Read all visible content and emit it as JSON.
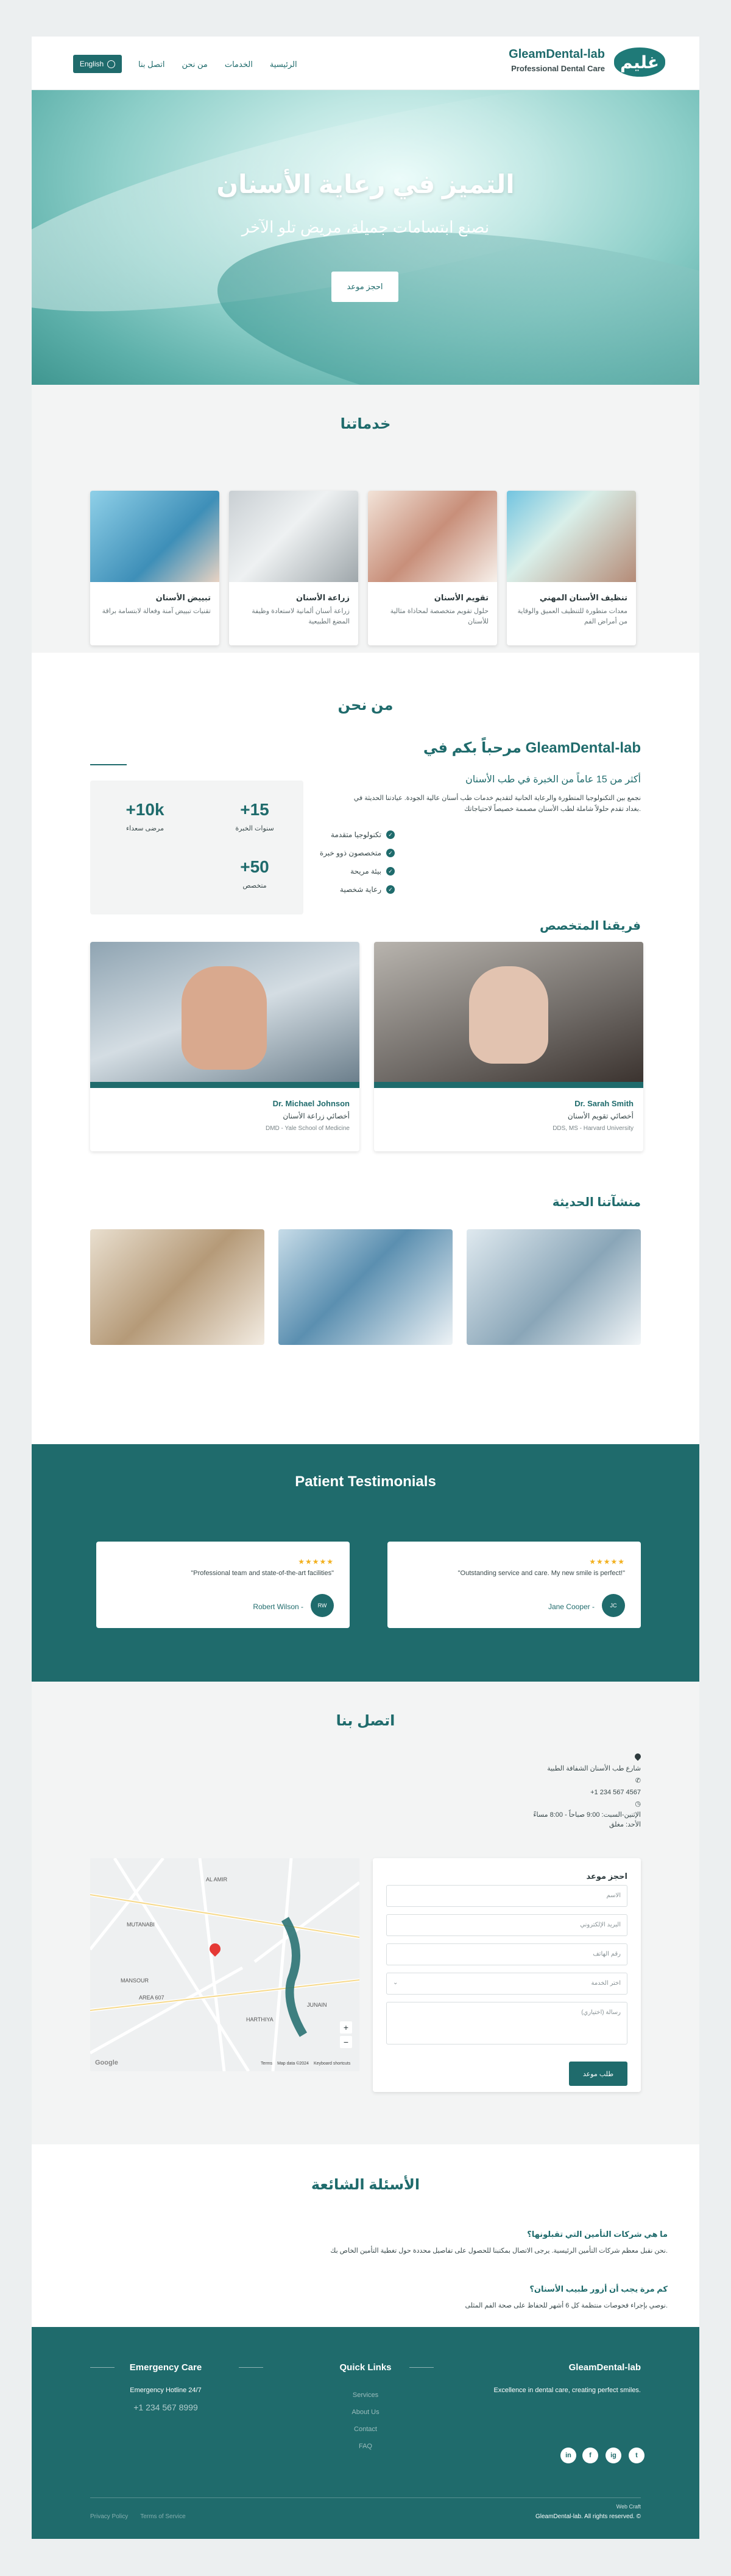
{
  "header": {
    "lang": "English",
    "nav": [
      "الرئيسية",
      "الخدمات",
      "من نحن",
      "اتصل بنا"
    ],
    "brand": "GleamDental-lab",
    "tagline": "Professional Dental Care",
    "logo_text": "غليم"
  },
  "hero": {
    "title": "التميز في رعاية الأسنان",
    "subtitle": "نصنع ابتسامات جميلة، مريض تلو الآخر",
    "cta": "احجز موعد"
  },
  "services": {
    "title": "خدماتنا",
    "items": [
      {
        "title": "تبييض الأسنان",
        "desc": "تقنيات تبييض آمنة وفعالة لابتسامة براقة"
      },
      {
        "title": "زراعة الأسنان",
        "desc": "زراعة أسنان ألمانية لاستعادة وظيفة المضغ الطبيعية"
      },
      {
        "title": "تقويم الأسنان",
        "desc": "حلول تقويم متخصصة لمحاذاة مثالية للأسنان"
      },
      {
        "title": "تنظيف الأسنان المهني",
        "desc": "معدات متطورة للتنظيف العميق والوقاية من أمراض الفم"
      }
    ]
  },
  "about": {
    "title": "من نحن",
    "heading": "مرحباً بكم في GleamDental-lab",
    "sub": "أكثر من 15 عاماً من الخبرة في طب الأسنان",
    "text1": "نجمع بين التكنولوجيا المتطورة والرعاية الحانية لتقديم خدمات طب أسنان عالية الجودة. عيادتنا الحديثة في",
    "text2": "بغداد تقدم حلولاً شاملة لطب الأسنان مصممة خصيصاً لاحتياجاتك.",
    "features": [
      "تكنولوجيا متقدمة",
      "متخصصون ذوو خبرة",
      "بيئة مريحة",
      "رعاية شخصية"
    ],
    "stats": [
      {
        "n": "+15",
        "l": "سنوات الخبرة"
      },
      {
        "n": "+10k",
        "l": "مرضى سعداء"
      },
      {
        "n": "+50",
        "l": "متخصص"
      }
    ],
    "team_title": "فريقنا المتخصص",
    "team": [
      {
        "name": "Dr. Sarah Smith",
        "role": "أخصائي تقويم الأسنان",
        "deg": "DDS, MS - Harvard University"
      },
      {
        "name": "Dr. Michael Johnson",
        "role": "أخصائي زراعة الأسنان",
        "deg": "DMD - Yale School of Medicine"
      }
    ],
    "fac_title": "منشآتنا الحديثة"
  },
  "testimonials": {
    "title": "Patient Testimonials",
    "stars": "★★★★★",
    "items": [
      {
        "quote": "\"Outstanding service and care. My new smile is perfect!\"",
        "name": "Jane Cooper -",
        "initials": "JC"
      },
      {
        "quote": "\"Professional team and state-of-the-art facilities\"",
        "name": "Robert Wilson -",
        "initials": "RW"
      }
    ]
  },
  "contact": {
    "title": "اتصل بنا",
    "address": "شارع طب الأسنان الشفافة الطبية",
    "phone": "+1 234 567 4567",
    "hours1": "الإثنين-السبت: 9:00 صباحاً - 8:00 مساءً",
    "hours2": "الأحد: مغلق",
    "form": {
      "title": "احجز موعد",
      "name": "الاسم",
      "email": "البريد الإلكتروني",
      "phone": "رقم الهاتف",
      "service": "اختر الخدمة",
      "message": "رسالة (اختياري)",
      "submit": "طلب موعد"
    },
    "map": {
      "labels": [
        "MUTANABI",
        "MANSOUR",
        "AREA 607",
        "HARTHIYA",
        "JUNAIN",
        "AL AMIR"
      ],
      "terms": "Terms",
      "report": "Map data ©2024",
      "keys": "Keyboard shortcuts",
      "google": "Google"
    }
  },
  "faq": {
    "title": "الأسئلة الشائعة",
    "items": [
      {
        "q": "ما هي شركات التأمين التي تقبلونها؟",
        "a": "نحن نقبل معظم شركات التأمين الرئيسية. يرجى الاتصال بمكتبنا للحصول على تفاصيل محددة حول تغطية التأمين الخاص بك."
      },
      {
        "q": "كم مرة يجب أن أزور طبيب الأسنان؟",
        "a": "نوصي بإجراء فحوصات منتظمة كل 6 أشهر للحفاظ على صحة الفم المثلى."
      }
    ]
  },
  "footer": {
    "col1": "GleamDental-lab",
    "col1_text": "Excellence in dental care, creating perfect smiles.",
    "col2": "Quick Links",
    "links": [
      "Services",
      "About Us",
      "Contact",
      "FAQ"
    ],
    "col3": "Emergency Care",
    "hotline": "Emergency Hotline 24/7",
    "phone": "+1 234 567 8999",
    "copyright": "GleamDental-lab. All rights reserved. ©",
    "privacy": "Privacy Policy",
    "terms": "Terms of Service",
    "social": [
      "f",
      "t",
      "in",
      "ig"
    ],
    "credit": "Web Craft"
  }
}
